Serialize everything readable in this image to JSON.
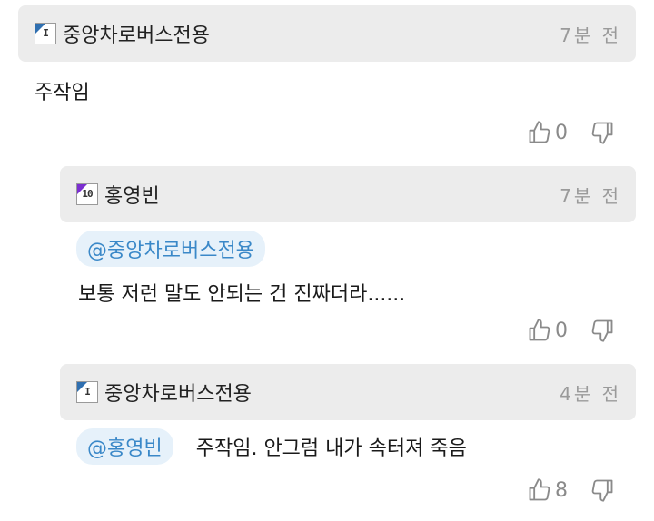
{
  "comments": [
    {
      "nickname": "중앙차로버스전용",
      "level_badge": "I",
      "time": "7분 전",
      "text": "주작임",
      "likes": "0"
    },
    {
      "nickname": "홍영빈",
      "level_badge": "10",
      "time": "7분 전",
      "mention": "@중앙차로버스전용",
      "text": "보통 저런 말도 안되는 건 진짜더라......",
      "likes": "0"
    },
    {
      "nickname": "중앙차로버스전용",
      "level_badge": "I",
      "time": "4분 전",
      "mention": "@홍영빈",
      "text": "주작임. 안그럼 내가 속터져 죽음",
      "likes": "8"
    }
  ],
  "icons": {
    "like": "thumbs-up-icon",
    "dislike": "thumbs-down-icon"
  },
  "colors": {
    "header_bg": "#ececec",
    "mention_text": "#3a88c8",
    "mention_bg": "#e6f1fa",
    "badge_blue": "#2f6fb0",
    "badge_purple": "#7b2fd0"
  }
}
